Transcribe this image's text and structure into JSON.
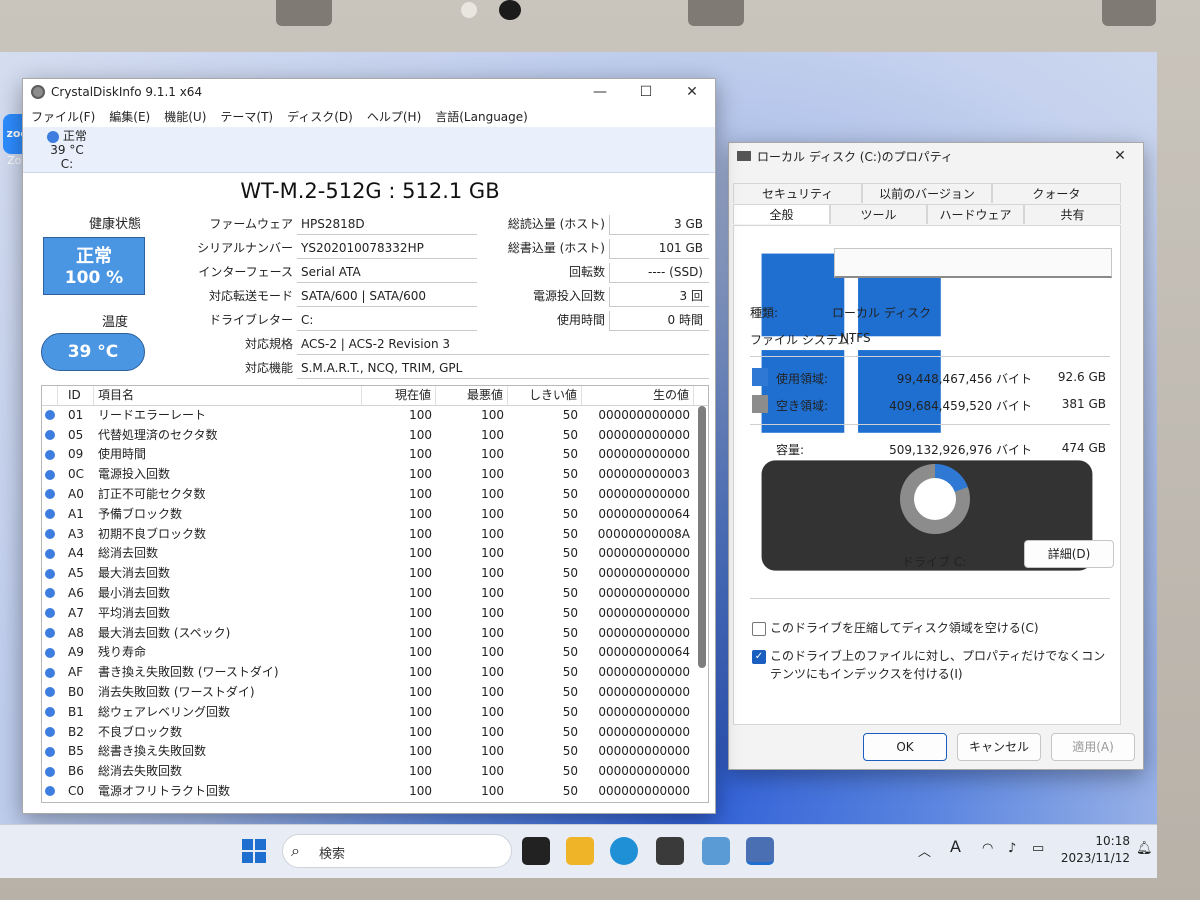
{
  "desktop": {
    "icon_label": "Zoom",
    "icon_logo": "zoom"
  },
  "cdi": {
    "title": "CrystalDiskInfo 9.1.1 x64",
    "menu": [
      "ファイル(F)",
      "編集(E)",
      "機能(U)",
      "テーマ(T)",
      "ディスク(D)",
      "ヘルプ(H)",
      "言語(Language)"
    ],
    "drive_tab": {
      "status": "正常",
      "temp": "39 °C",
      "letter": "C:"
    },
    "model": "WT-M.2-512G : 512.1 GB",
    "health_label": "健康状態",
    "health_status": "正常",
    "health_percent": "100 %",
    "temp_label": "温度",
    "temp_value": "39 °C",
    "left_info": [
      {
        "key": "ファームウェア",
        "value": "HPS2818D"
      },
      {
        "key": "シリアルナンバー",
        "value": "YS202010078332HP"
      },
      {
        "key": "インターフェース",
        "value": "Serial ATA"
      },
      {
        "key": "対応転送モード",
        "value": "SATA/600 | SATA/600"
      },
      {
        "key": "ドライブレター",
        "value": "C:"
      }
    ],
    "right_info": [
      {
        "key": "総読込量 (ホスト)",
        "value": "3 GB"
      },
      {
        "key": "総書込量 (ホスト)",
        "value": "101 GB"
      },
      {
        "key": "回転数",
        "value": "---- (SSD)"
      },
      {
        "key": "電源投入回数",
        "value": "3 回"
      },
      {
        "key": "使用時間",
        "value": "0 時間"
      }
    ],
    "standard_key": "対応規格",
    "standard_value": "ACS-2 | ACS-2 Revision 3",
    "features_key": "対応機能",
    "features_value": "S.M.A.R.T., NCQ, TRIM, GPL",
    "smart_headers": [
      "ID",
      "項目名",
      "現在値",
      "最悪値",
      "しきい値",
      "生の値"
    ],
    "smart_rows": [
      {
        "id": "01",
        "name": "リードエラーレート",
        "cur": "100",
        "worst": "100",
        "thr": "50",
        "raw": "000000000000"
      },
      {
        "id": "05",
        "name": "代替処理済のセクタ数",
        "cur": "100",
        "worst": "100",
        "thr": "50",
        "raw": "000000000000"
      },
      {
        "id": "09",
        "name": "使用時間",
        "cur": "100",
        "worst": "100",
        "thr": "50",
        "raw": "000000000000"
      },
      {
        "id": "0C",
        "name": "電源投入回数",
        "cur": "100",
        "worst": "100",
        "thr": "50",
        "raw": "000000000003"
      },
      {
        "id": "A0",
        "name": "訂正不可能セクタ数",
        "cur": "100",
        "worst": "100",
        "thr": "50",
        "raw": "000000000000"
      },
      {
        "id": "A1",
        "name": "予備ブロック数",
        "cur": "100",
        "worst": "100",
        "thr": "50",
        "raw": "000000000064"
      },
      {
        "id": "A3",
        "name": "初期不良ブロック数",
        "cur": "100",
        "worst": "100",
        "thr": "50",
        "raw": "00000000008A"
      },
      {
        "id": "A4",
        "name": "総消去回数",
        "cur": "100",
        "worst": "100",
        "thr": "50",
        "raw": "000000000000"
      },
      {
        "id": "A5",
        "name": "最大消去回数",
        "cur": "100",
        "worst": "100",
        "thr": "50",
        "raw": "000000000000"
      },
      {
        "id": "A6",
        "name": "最小消去回数",
        "cur": "100",
        "worst": "100",
        "thr": "50",
        "raw": "000000000000"
      },
      {
        "id": "A7",
        "name": "平均消去回数",
        "cur": "100",
        "worst": "100",
        "thr": "50",
        "raw": "000000000000"
      },
      {
        "id": "A8",
        "name": "最大消去回数 (スペック)",
        "cur": "100",
        "worst": "100",
        "thr": "50",
        "raw": "000000000000"
      },
      {
        "id": "A9",
        "name": "残り寿命",
        "cur": "100",
        "worst": "100",
        "thr": "50",
        "raw": "000000000064"
      },
      {
        "id": "AF",
        "name": "書き換え失敗回数 (ワーストダイ)",
        "cur": "100",
        "worst": "100",
        "thr": "50",
        "raw": "000000000000"
      },
      {
        "id": "B0",
        "name": "消去失敗回数 (ワーストダイ)",
        "cur": "100",
        "worst": "100",
        "thr": "50",
        "raw": "000000000000"
      },
      {
        "id": "B1",
        "name": "総ウェアレベリング回数",
        "cur": "100",
        "worst": "100",
        "thr": "50",
        "raw": "000000000000"
      },
      {
        "id": "B2",
        "name": "不良ブロック数",
        "cur": "100",
        "worst": "100",
        "thr": "50",
        "raw": "000000000000"
      },
      {
        "id": "B5",
        "name": "総書き換え失敗回数",
        "cur": "100",
        "worst": "100",
        "thr": "50",
        "raw": "000000000000"
      },
      {
        "id": "B6",
        "name": "総消去失敗回数",
        "cur": "100",
        "worst": "100",
        "thr": "50",
        "raw": "000000000000"
      },
      {
        "id": "C0",
        "name": "電源オフリトラクト回数",
        "cur": "100",
        "worst": "100",
        "thr": "50",
        "raw": "000000000000"
      }
    ]
  },
  "props": {
    "title": "ローカル ディスク (C:)のプロパティ",
    "tabs_row1": [
      "セキュリティ",
      "以前のバージョン",
      "クォータ"
    ],
    "tabs_row2": [
      "全般",
      "ツール",
      "ハードウェア",
      "共有"
    ],
    "selected_tab": "全般",
    "type_label": "種類:",
    "type_value": "ローカル ディスク",
    "fs_label": "ファイル システム:",
    "fs_value": "NTFS",
    "used_label": "使用領域:",
    "used_bytes": "99,448,467,456 バイト",
    "used_size": "92.6 GB",
    "free_label": "空き領域:",
    "free_bytes": "409,684,459,520 バイト",
    "free_size": "381 GB",
    "cap_label": "容量:",
    "cap_bytes": "509,132,926,976 バイト",
    "cap_size": "474 GB",
    "used_fraction": 0.195,
    "drive_label": "ドライブ C:",
    "details_button": "詳細(D)",
    "compress_label": "このドライブを圧縮してディスク領域を空ける(C)",
    "compress_checked": false,
    "index_label": "このドライブ上のファイルに対し、プロパティだけでなくコンテンツにもインデックスを付ける(I)",
    "index_checked": true,
    "ok": "OK",
    "cancel": "キャンセル",
    "apply": "適用(A)",
    "colors": {
      "used": "#2f78d4",
      "free": "#8c8c8c"
    }
  },
  "taskbar": {
    "search_placeholder": "検索",
    "time": "10:18",
    "date": "2023/11/12",
    "ime": "A"
  },
  "colors": {
    "accent": "#4b96e3",
    "status_dot": "#3d7de0"
  }
}
